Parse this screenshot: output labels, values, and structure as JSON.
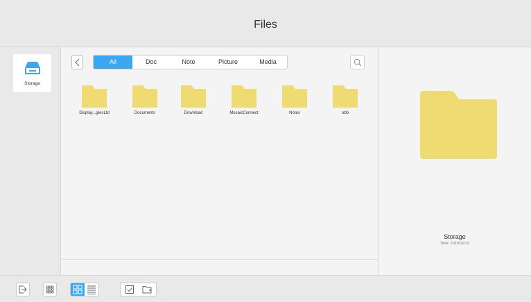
{
  "app": {
    "title": "Files"
  },
  "sidebar": {
    "storage_label": "Storage"
  },
  "tabs": [
    {
      "label": "All",
      "active": true
    },
    {
      "label": "Doc",
      "active": false
    },
    {
      "label": "Note",
      "active": false
    },
    {
      "label": "Picture",
      "active": false
    },
    {
      "label": "Media",
      "active": false
    }
  ],
  "folders": [
    {
      "name": "Display...giesLtd"
    },
    {
      "name": "Documents"
    },
    {
      "name": "Download"
    },
    {
      "name": "MosaicConnect"
    },
    {
      "name": "Notes"
    },
    {
      "name": "obb"
    }
  ],
  "preview": {
    "name": "Storage",
    "time": "Time: 2019/12/10"
  },
  "colors": {
    "accent": "#3aa7f3",
    "folder": "#f0da72",
    "background": "#e9e9e9",
    "panel": "#f4f4f4"
  },
  "icons": {
    "storage": "storage-icon",
    "back": "chevron-left-icon",
    "search": "search-icon",
    "exit": "exit-icon",
    "apps": "apps-grid-icon",
    "grid_view": "grid-view-icon",
    "list_view": "list-view-icon",
    "select": "checkbox-icon",
    "new_folder": "new-folder-icon"
  }
}
